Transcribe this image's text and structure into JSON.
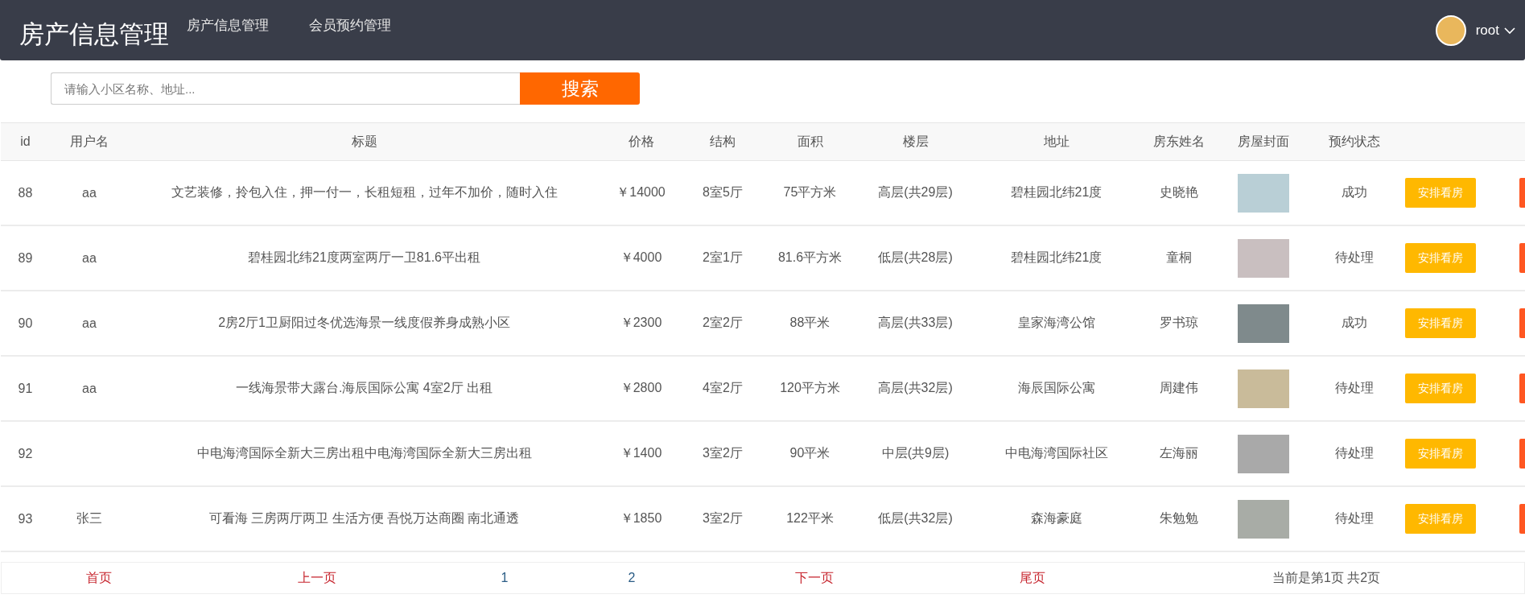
{
  "header": {
    "title": "房产信息管理",
    "nav": [
      {
        "label": "房产信息管理"
      },
      {
        "label": "会员预约管理"
      }
    ],
    "user": "root"
  },
  "search": {
    "placeholder": "请输入小区名称、地址...",
    "button": "搜索"
  },
  "table": {
    "columns": [
      "id",
      "用户名",
      "标题",
      "价格",
      "结构",
      "面积",
      "楼层",
      "地址",
      "房东姓名",
      "房屋封面",
      "预约状态"
    ],
    "rows": [
      {
        "id": "88",
        "username": "aa",
        "title": "文艺装修，拎包入住，押一付一，长租短租，过年不加价，随时入住",
        "price": "￥14000",
        "structure": "8室5厅",
        "area": "75平方米",
        "floor": "高层(共29层)",
        "address": "碧桂园北纬21度",
        "landlord": "史晓艳",
        "status": "成功",
        "action": "安排看房"
      },
      {
        "id": "89",
        "username": "aa",
        "title": "碧桂园北纬21度两室两厅一卫81.6平出租",
        "price": "￥4000",
        "structure": "2室1厅",
        "area": "81.6平方米",
        "floor": "低层(共28层)",
        "address": "碧桂园北纬21度",
        "landlord": "童桐",
        "status": "待处理",
        "action": "安排看房"
      },
      {
        "id": "90",
        "username": "aa",
        "title": "2房2厅1卫厨阳过冬优选海景一线度假养身成熟小区",
        "price": "￥2300",
        "structure": "2室2厅",
        "area": "88平米",
        "floor": "高层(共33层)",
        "address": "皇家海湾公馆",
        "landlord": "罗书琼",
        "status": "成功",
        "action": "安排看房"
      },
      {
        "id": "91",
        "username": "aa",
        "title": "一线海景带大露台.海辰国际公寓 4室2厅 出租",
        "price": "￥2800",
        "structure": "4室2厅",
        "area": "120平方米",
        "floor": "高层(共32层)",
        "address": "海辰国际公寓",
        "landlord": "周建伟",
        "status": "待处理",
        "action": "安排看房"
      },
      {
        "id": "92",
        "title": "中电海湾国际全新大三房出租中电海湾国际全新大三房出租",
        "price": "￥1400",
        "structure": "3室2厅",
        "area": "90平米",
        "floor": "中层(共9层)",
        "address": "中电海湾国际社区",
        "landlord": "左海丽",
        "status": "待处理",
        "action": "安排看房"
      },
      {
        "id": "93",
        "username": "张三",
        "title": "可看海 三房两厅两卫 生活方便 吾悦万达商圈 南北通透",
        "price": "￥1850",
        "structure": "3室2厅",
        "area": "122平米",
        "floor": "低层(共32层)",
        "address": "森海豪庭",
        "landlord": "朱勉勉",
        "status": "待处理",
        "action": "安排看房"
      }
    ]
  },
  "pagination": [
    {
      "kind": "link",
      "label": "首页"
    },
    {
      "kind": "link",
      "label": "上一页"
    },
    {
      "kind": "page",
      "label": "1"
    },
    {
      "kind": "page",
      "label": "2"
    },
    {
      "kind": "link",
      "label": "下一页"
    },
    {
      "kind": "link",
      "label": "尾页"
    },
    {
      "kind": "info",
      "label": "当前是第1页 共2页"
    }
  ]
}
